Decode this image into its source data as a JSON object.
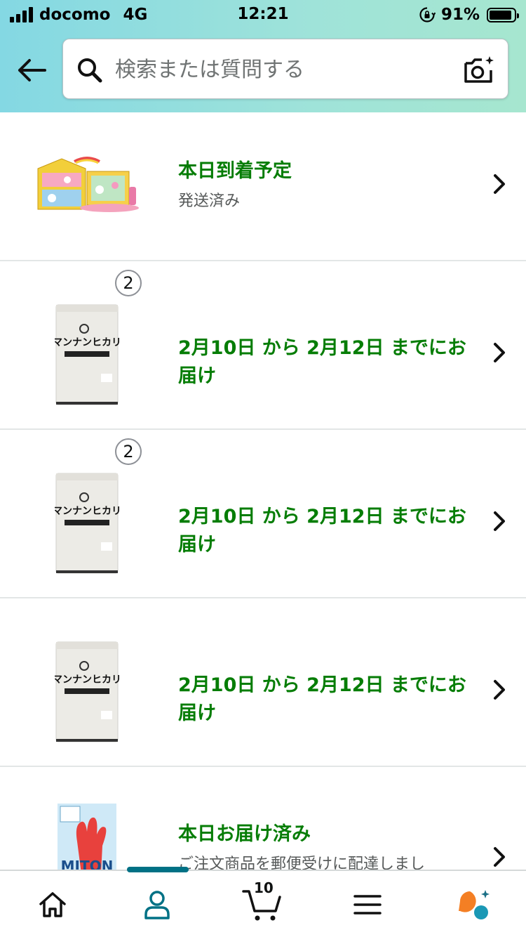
{
  "status_bar": {
    "carrier": "docomo",
    "network": "4G",
    "time": "12:21",
    "battery_percent": "91%",
    "battery_level": 0.91
  },
  "search": {
    "placeholder": "検索または質問する",
    "value": ""
  },
  "icons": {
    "back": "back-arrow-icon",
    "search": "search-icon",
    "camera": "camera-icon",
    "chevron": "chevron-right-icon",
    "home": "home-icon",
    "account": "account-icon",
    "cart": "cart-icon",
    "menu": "menu-icon",
    "assistant": "assistant-icon"
  },
  "orders": [
    {
      "title": "本日到着予定",
      "subtitle": "発送済み",
      "product": "toy-house",
      "quantity": ""
    },
    {
      "title": "2月10日 から 2月12日 までにお届け",
      "subtitle": "",
      "product": "rice-bag",
      "quantity": "2"
    },
    {
      "title": "2月10日 から 2月12日 までにお届け",
      "subtitle": "",
      "product": "rice-bag",
      "quantity": "2"
    },
    {
      "title": "2月10日 から 2月12日 までにお届け",
      "subtitle": "",
      "product": "rice-bag",
      "quantity": ""
    },
    {
      "title": "本日お届け済み",
      "subtitle": "ご注文商品を郵便受けに配達しまし",
      "product": "miton-gloves",
      "quantity": ""
    }
  ],
  "product_labels": {
    "rice_brand": "マンナンヒカリ",
    "gloves_brand": "MITON"
  },
  "bottom_nav": {
    "cart_count": "10",
    "active_tab": "account"
  },
  "colors": {
    "header_gradient_start": "#84d8e3",
    "header_gradient_end": "#a6e6cf",
    "delivery_green": "#067d06",
    "active_tab_teal": "#007185",
    "assistant_orange": "#f47f24",
    "assistant_teal": "#1a98b5"
  }
}
